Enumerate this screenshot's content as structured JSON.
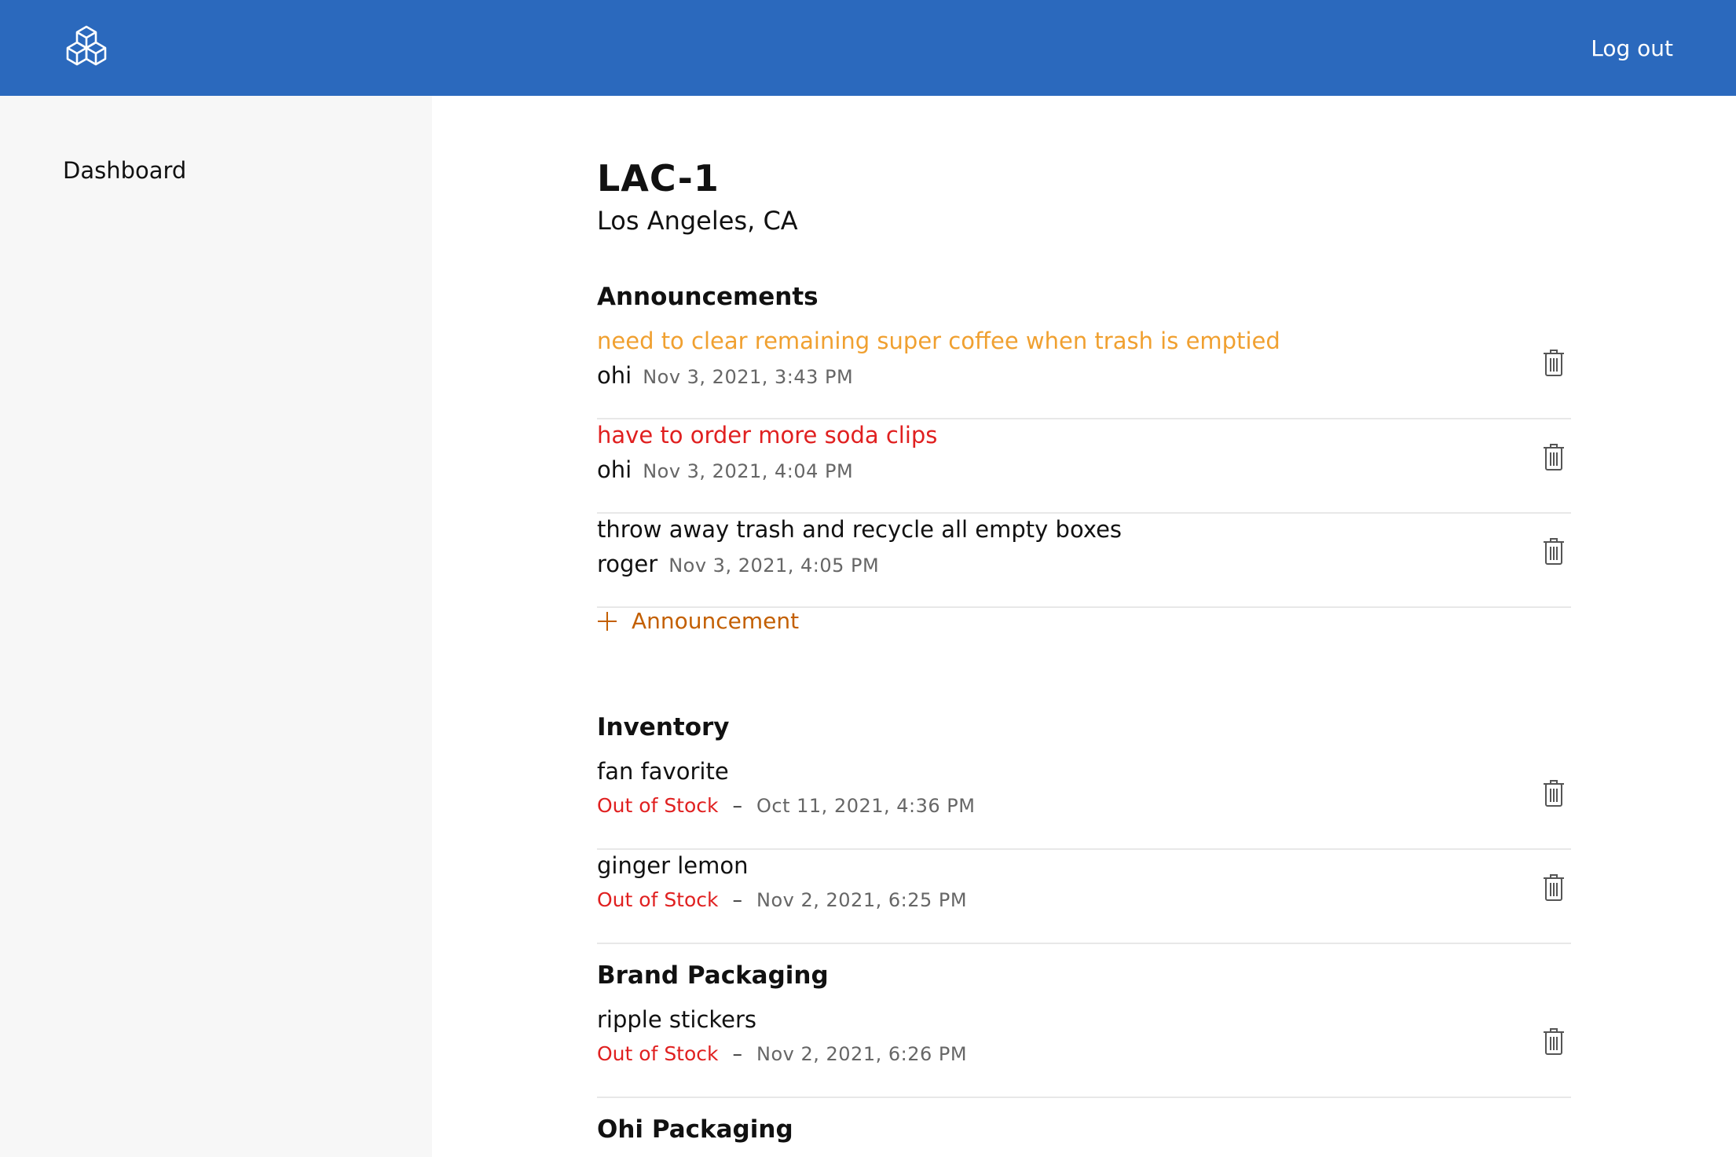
{
  "header": {
    "logo_icon": "cubes-logo-icon",
    "logout_label": "Log out",
    "bar_color": "#2b69bd"
  },
  "sidebar": {
    "items": [
      {
        "label": "Dashboard"
      }
    ]
  },
  "location": {
    "code": "LAC-1",
    "city": "Los Angeles, CA"
  },
  "announcements": {
    "heading": "Announcements",
    "items": [
      {
        "text": "need to clear remaining super coffee when trash is emptied",
        "author": "ohi",
        "time": "Nov 3, 2021, 3:43 PM",
        "color": "#f0a030"
      },
      {
        "text": "have to order more soda clips",
        "author": "ohi",
        "time": "Nov 3, 2021, 4:04 PM",
        "color": "#e02020"
      },
      {
        "text": "throw away trash and recycle all empty boxes",
        "author": "roger",
        "time": "Nov 3, 2021, 4:05 PM",
        "color": "#111111"
      }
    ],
    "add_label": "Announcement",
    "add_icon": "plus-icon"
  },
  "inventory": {
    "heading": "Inventory",
    "items": [
      {
        "name": "fan favorite",
        "status": "Out of Stock",
        "separator": "–",
        "time": "Oct 11, 2021, 4:36 PM"
      },
      {
        "name": "ginger lemon",
        "status": "Out of Stock",
        "separator": "–",
        "time": "Nov 2, 2021, 6:25 PM"
      }
    ]
  },
  "brand_packaging": {
    "heading": "Brand Packaging",
    "items": [
      {
        "name": "ripple stickers",
        "status": "Out of Stock",
        "separator": "–",
        "time": "Nov 2, 2021, 6:26 PM"
      }
    ]
  },
  "ohi_packaging": {
    "heading": "Ohi Packaging"
  },
  "icons": {
    "delete": "trash-icon"
  }
}
